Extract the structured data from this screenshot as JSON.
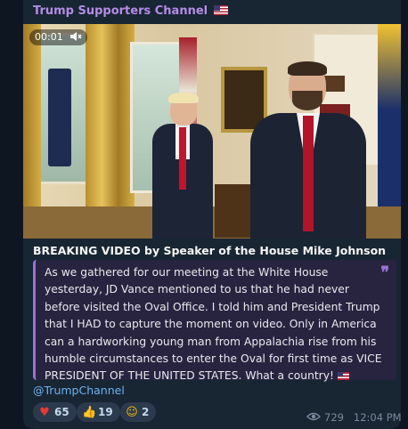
{
  "channel": {
    "name": "Trump Supporters Channel",
    "flag_icon": "us-flag-icon"
  },
  "video": {
    "time": "00:01",
    "mute_icon": "speaker-muted-icon"
  },
  "post": {
    "headline": "BREAKING VIDEO by Speaker of the House Mike Johnson",
    "quote": "As we gathered for our meeting at the White House yesterday, JD Vance mentioned to us that he had never before visited the Oval Office. I told him and President Trump that I HAD to capture the moment on video. Only in America can a hardworking young man from Appalachia rise from his humble circumstances to enter the Oval for first time as VICE PRESIDENT OF THE UNITED STATES. What a country!",
    "quote_icon": "quote-icon",
    "link": "@TrumpChannel"
  },
  "reactions": [
    {
      "emoji": "heart",
      "count": "65",
      "color": "#e53935"
    },
    {
      "emoji": "thumbs-up",
      "count": "19",
      "color": "#f5b700"
    },
    {
      "emoji": "starstruck-face",
      "count": "2",
      "color": "#f5b700"
    }
  ],
  "meta": {
    "views": "729",
    "time": "12:04 PM"
  },
  "colors": {
    "accent": "#b58ce6",
    "link": "#6ab3f3",
    "quote_border": "#9a71d6",
    "background": "#0e1621",
    "bubble": "#182533"
  }
}
